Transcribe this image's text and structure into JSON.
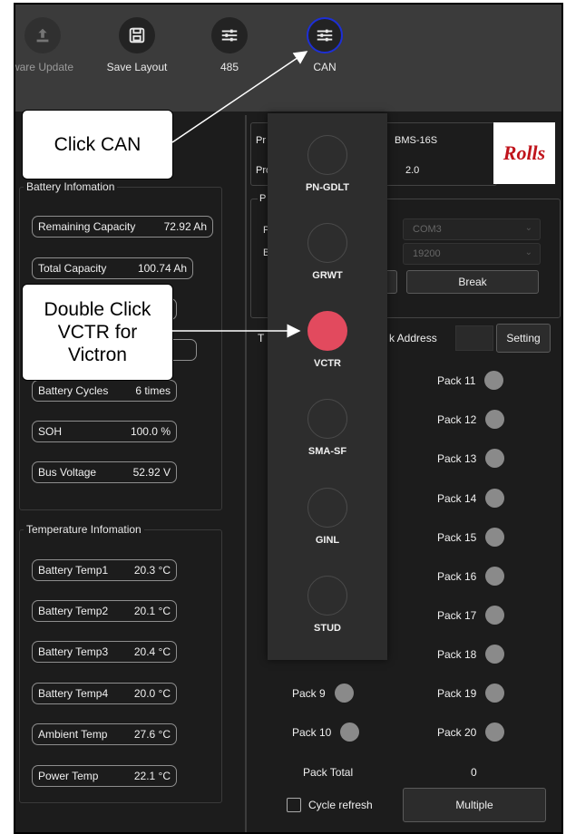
{
  "toolbar": {
    "firmware_label": "ware Update",
    "save_layout_label": "Save Layout",
    "btn_485_label": "485",
    "can_label": "CAN"
  },
  "battery_info": {
    "title": "Battery Infomation",
    "rows": [
      {
        "label": "Remaining Capacity",
        "value": "72.92 Ah"
      },
      {
        "label": "Total Capacity",
        "value": "100.74 Ah"
      },
      {
        "label": "Battery Cycles",
        "value": "6 times"
      },
      {
        "label": "SOH",
        "value": "100.0 %"
      },
      {
        "label": "Bus Voltage",
        "value": "52.92 V"
      }
    ]
  },
  "temperature_info": {
    "title": "Temperature Infomation",
    "rows": [
      {
        "label": "Battery Temp1",
        "value": "20.3 °C"
      },
      {
        "label": "Battery Temp2",
        "value": "20.1 °C"
      },
      {
        "label": "Battery Temp3",
        "value": "20.4 °C"
      },
      {
        "label": "Battery Temp4",
        "value": "20.0 °C"
      },
      {
        "label": "Ambient Temp",
        "value": "27.6 °C"
      },
      {
        "label": "Power Temp",
        "value": "22.1 °C"
      }
    ]
  },
  "product": {
    "frag1": "Pr",
    "frag2": "Pro",
    "model": "BMS-16S",
    "version": "2.0",
    "logo_text": "Rolls"
  },
  "port_settings": {
    "frag_title": "P",
    "frag_port": "P",
    "frag_baud": "B",
    "port_value": "COM3",
    "baud_value": "19200",
    "break_label": "Break"
  },
  "pack_address": {
    "frag": "T",
    "label": "k Address",
    "value": "",
    "setting_label": "Setting"
  },
  "packs_left": [
    {
      "label": "Pack 9"
    },
    {
      "label": "Pack 10"
    }
  ],
  "packs_right": [
    {
      "label": "Pack 11"
    },
    {
      "label": "Pack 12"
    },
    {
      "label": "Pack 13"
    },
    {
      "label": "Pack 14"
    },
    {
      "label": "Pack 15"
    },
    {
      "label": "Pack 16"
    },
    {
      "label": "Pack 17"
    },
    {
      "label": "Pack 18"
    },
    {
      "label": "Pack 19"
    },
    {
      "label": "Pack 20"
    }
  ],
  "pack_total": {
    "label": "Pack Total",
    "value": "0"
  },
  "cycle_refresh_label": "Cycle refresh",
  "multiple_label": "Multiple",
  "can_protocols": [
    {
      "label": "PN-GDLT",
      "selected": false
    },
    {
      "label": "GRWT",
      "selected": false
    },
    {
      "label": "VCTR",
      "selected": true
    },
    {
      "label": "SMA-SF",
      "selected": false
    },
    {
      "label": "GINL",
      "selected": false
    },
    {
      "label": "STUD",
      "selected": false
    }
  ],
  "callouts": {
    "click_can": "Click CAN",
    "double_click_line1": "Double Click",
    "double_click_line2": "VCTR for",
    "double_click_line3": "Victron"
  },
  "colors": {
    "selected_protocol": "#e24a5e",
    "can_highlight": "#1d2fd6",
    "logo_red": "#c0141c"
  }
}
